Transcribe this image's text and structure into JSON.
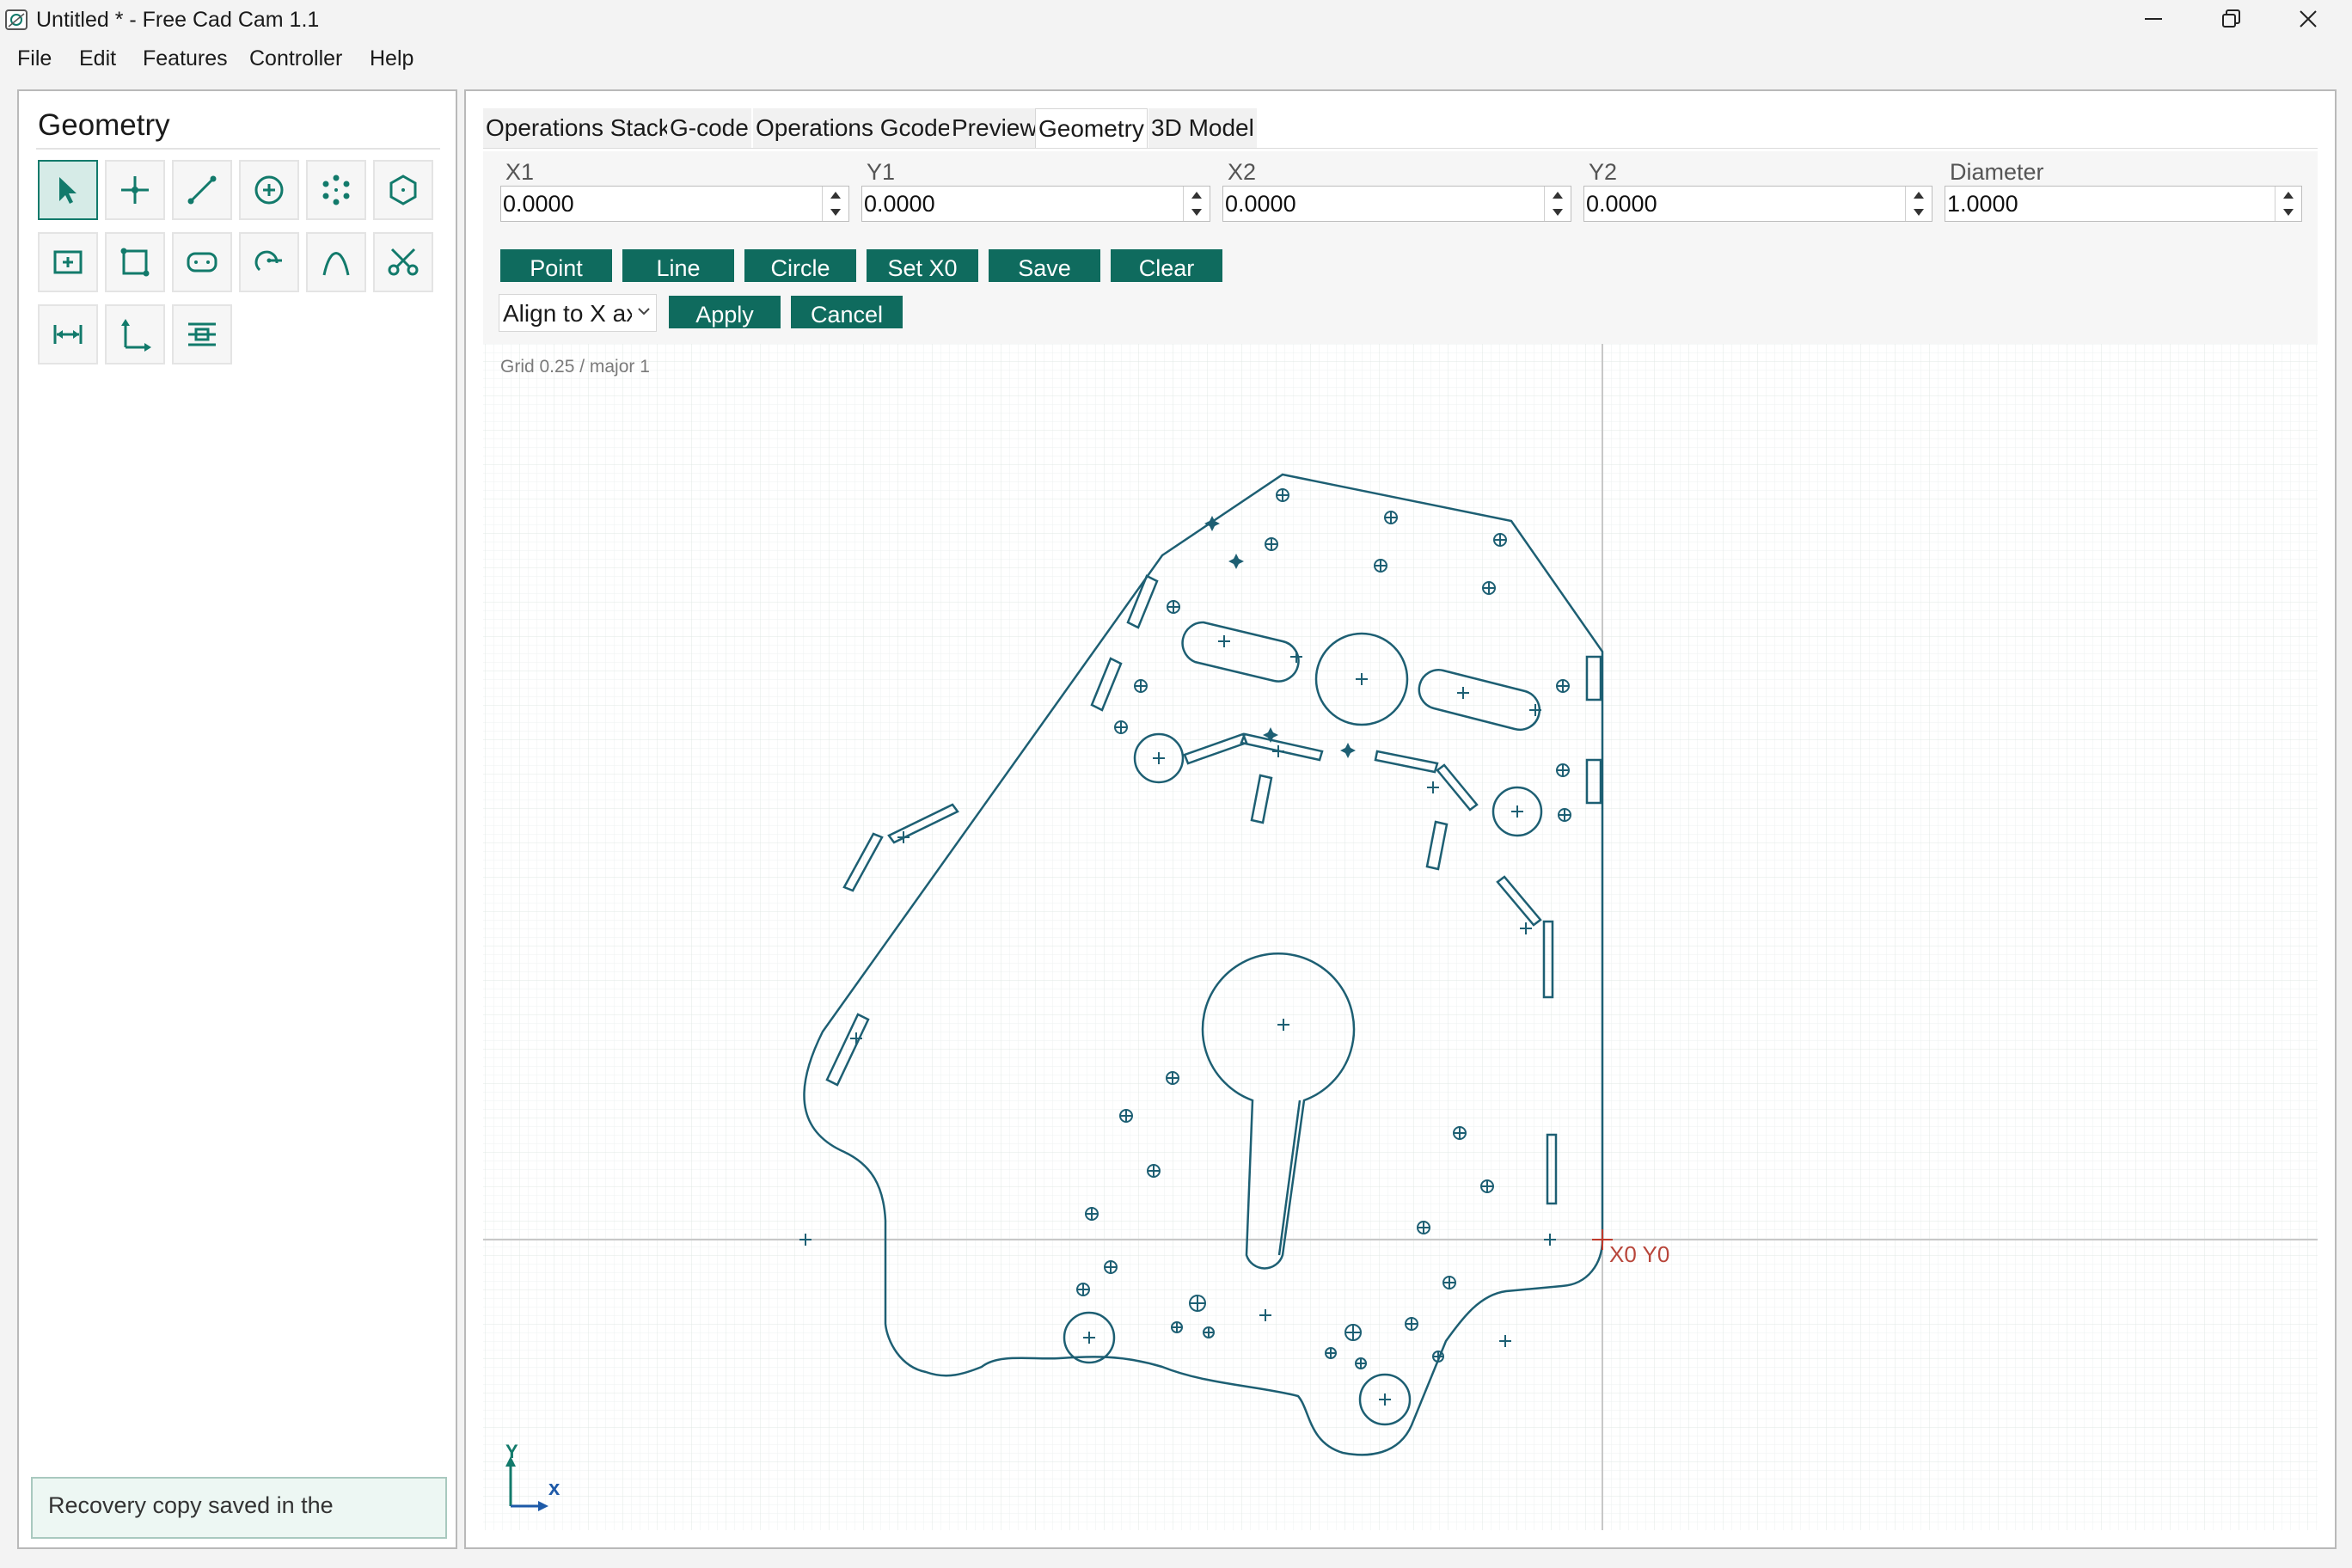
{
  "window": {
    "title": "Untitled * - Free Cad Cam 1.1"
  },
  "menu": [
    "File",
    "Edit",
    "Features",
    "Controller",
    "Help"
  ],
  "left_panel": {
    "title": "Geometry",
    "tools": [
      {
        "name": "select-tool",
        "icon": "arrow-cursor-icon"
      },
      {
        "name": "point-tool",
        "icon": "point-cross-icon"
      },
      {
        "name": "line-tool",
        "icon": "line-icon"
      },
      {
        "name": "circle-tool",
        "icon": "circle-center-icon"
      },
      {
        "name": "bolt-circle-tool",
        "icon": "bolt-circle-icon"
      },
      {
        "name": "polygon-tool",
        "icon": "hexagon-icon"
      },
      {
        "name": "rectangle-center-tool",
        "icon": "rectangle-center-icon"
      },
      {
        "name": "rectangle-corner-tool",
        "icon": "rectangle-corner-icon"
      },
      {
        "name": "slot-tool",
        "icon": "rounded-slot-icon"
      },
      {
        "name": "arc-tool",
        "icon": "arc-icon"
      },
      {
        "name": "curve-tool",
        "icon": "curve-icon"
      },
      {
        "name": "trim-tool",
        "icon": "scissors-icon"
      },
      {
        "name": "measure-tool",
        "icon": "measure-icon"
      },
      {
        "name": "axis-tool",
        "icon": "axes-icon"
      },
      {
        "name": "align-tool",
        "icon": "align-center-icon"
      }
    ],
    "status_text": "Recovery copy saved in the"
  },
  "tabs": [
    {
      "label": "Operations Stack",
      "active": false
    },
    {
      "label": "G-code",
      "active": false
    },
    {
      "label": "Operations Gcode",
      "active": false
    },
    {
      "label": "Preview",
      "active": false
    },
    {
      "label": "Geometry",
      "active": true
    },
    {
      "label": "3D Model",
      "active": false
    }
  ],
  "form": {
    "fields": [
      {
        "label": "X1",
        "value": "0.0000"
      },
      {
        "label": "Y1",
        "value": "0.0000"
      },
      {
        "label": "X2",
        "value": "0.0000"
      },
      {
        "label": "Y2",
        "value": "0.0000"
      },
      {
        "label": "Diameter",
        "value": "1.0000"
      }
    ],
    "buttons": [
      "Point",
      "Line",
      "Circle",
      "Set X0",
      "Save",
      "Clear"
    ],
    "align_select": "Align to X axis",
    "apply_label": "Apply",
    "cancel_label": "Cancel"
  },
  "canvas": {
    "grid_label": "Grid 0.25 / major 1",
    "origin_label": "X0 Y0",
    "axis_x_label": "x",
    "axis_y_label": "Y"
  },
  "colors": {
    "accent": "#0f6b5e",
    "geometry": "#1d5f73",
    "origin": "#c0392b"
  }
}
